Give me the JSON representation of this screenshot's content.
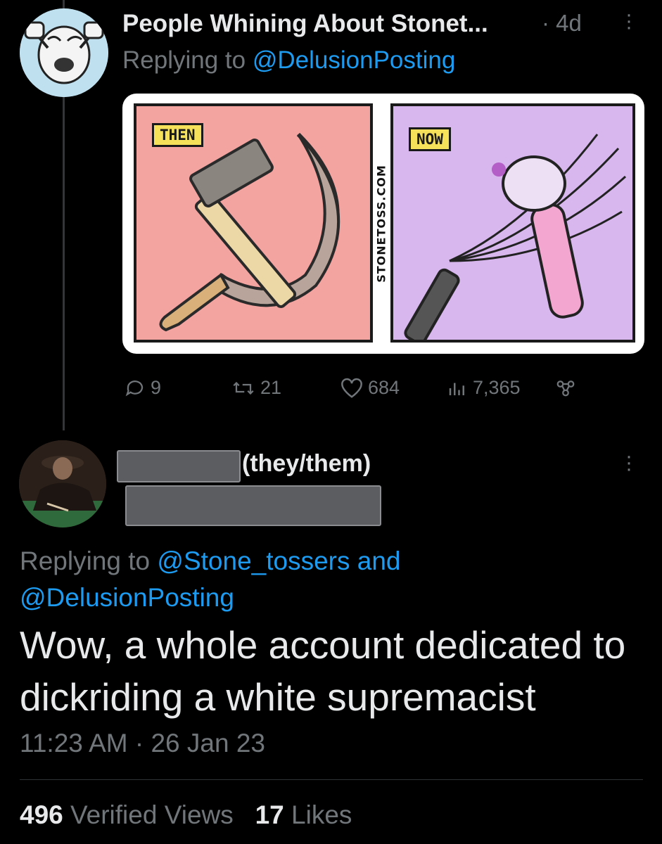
{
  "original_tweet": {
    "display_name": "People Whining About Stonet...",
    "time": "· 4d",
    "replying_prefix": "Replying to",
    "replying_handle": "@DelusionPosting",
    "comic": {
      "then_label": "THEN",
      "now_label": "NOW",
      "watermark": "STONETOSS.COM"
    },
    "actions": {
      "replies": "9",
      "retweets": "21",
      "likes": "684",
      "views": "7,365"
    }
  },
  "reply_tweet": {
    "pronouns": "(they/them)",
    "replying_prefix": "Replying to",
    "replying_handle1": "@Stone_tossers",
    "replying_and": "and",
    "replying_handle2": "@DelusionPosting",
    "text": "Wow, a whole account dedicated to dickriding a white supremacist",
    "timestamp": "11:23 AM · 26 Jan 23",
    "views_count": "496",
    "views_label": "Verified Views",
    "likes_count": "17",
    "likes_label": "Likes"
  },
  "colors": {
    "background": "#000000",
    "text_primary": "#e7e9ea",
    "text_secondary": "#71767b",
    "link": "#1d9bf0"
  }
}
